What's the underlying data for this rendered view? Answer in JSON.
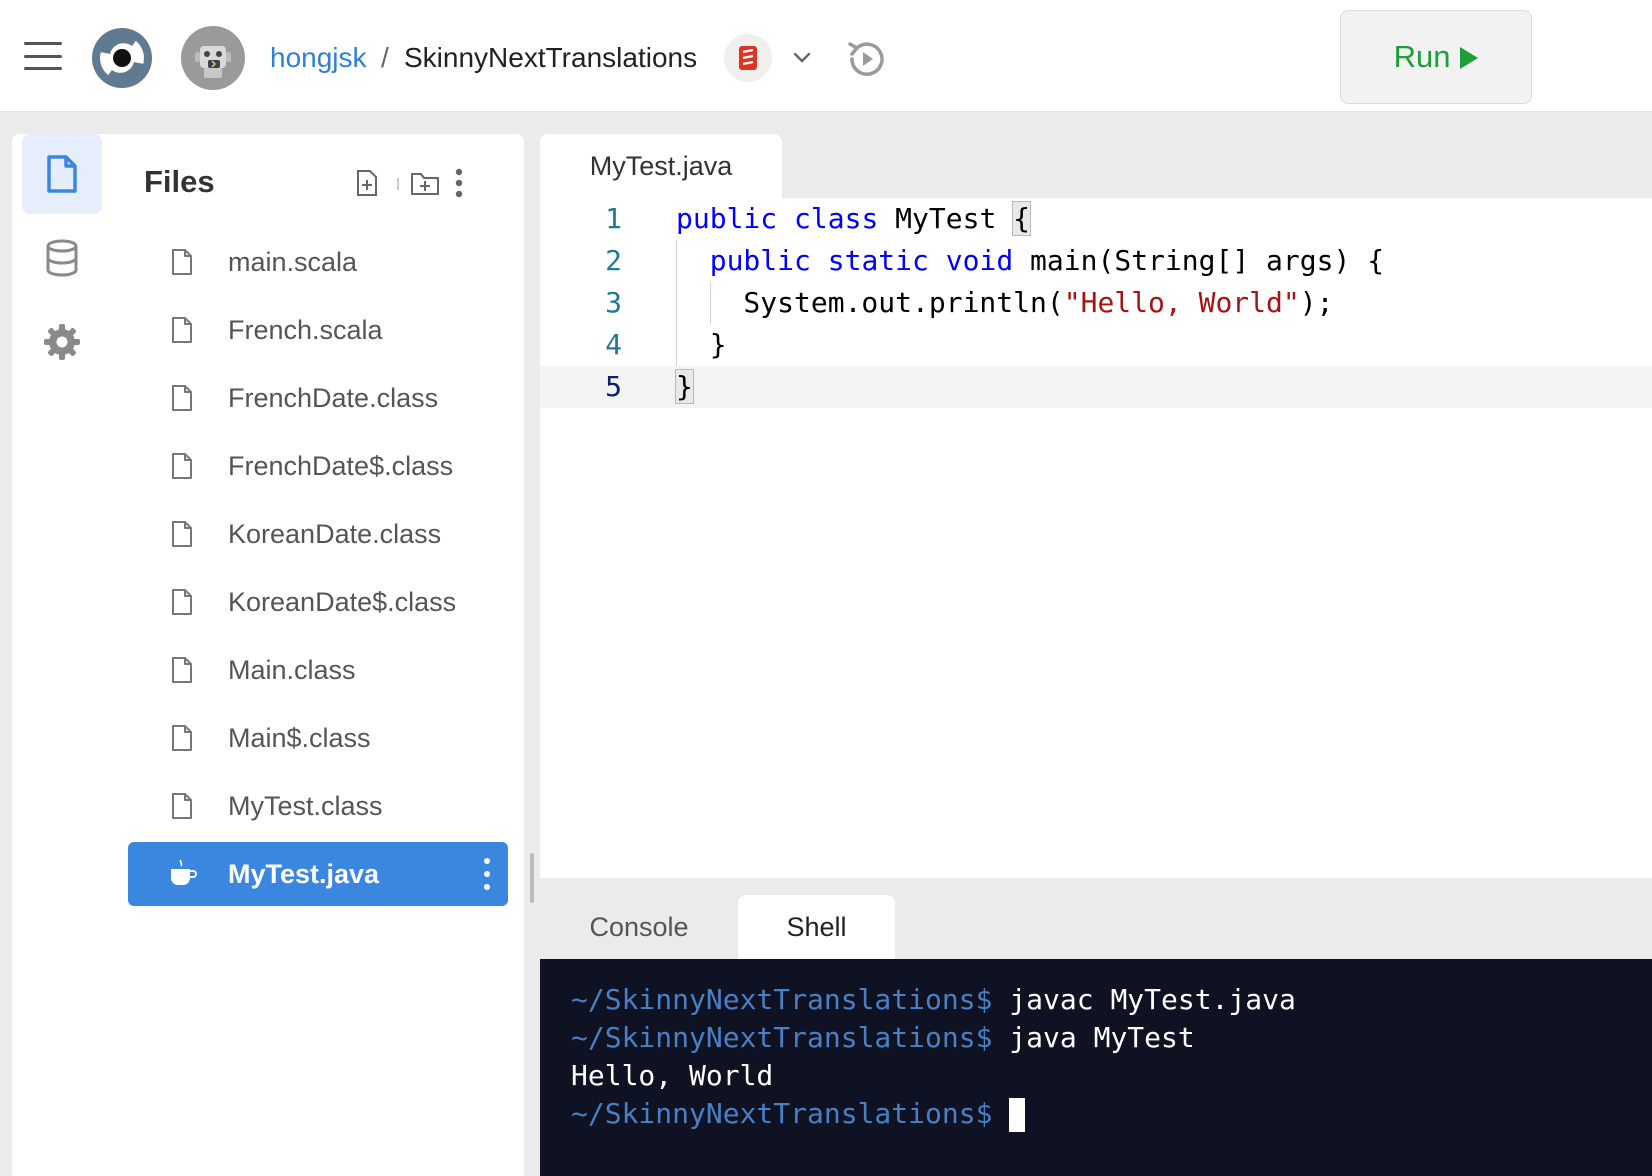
{
  "header": {
    "username": "hongjsk",
    "separator": "/",
    "repl_name": "SkinnyNextTranslations",
    "run_label": "Run"
  },
  "files_panel": {
    "title": "Files",
    "items": [
      {
        "name": "main.scala"
      },
      {
        "name": "French.scala"
      },
      {
        "name": "FrenchDate.class"
      },
      {
        "name": "FrenchDate$.class"
      },
      {
        "name": "KoreanDate.class"
      },
      {
        "name": "KoreanDate$.class"
      },
      {
        "name": "Main.class"
      },
      {
        "name": "Main$.class"
      },
      {
        "name": "MyTest.class"
      },
      {
        "name": "MyTest.java",
        "active": true
      }
    ]
  },
  "editor": {
    "tab_label": "MyTest.java",
    "line_numbers": [
      "1",
      "2",
      "3",
      "4",
      "5"
    ],
    "current_line": 5
  },
  "bottom_panel": {
    "tabs": [
      "Console",
      "Shell"
    ],
    "active_tab": "Shell",
    "terminal_lines": [
      {
        "prompt": "~/SkinnyNextTranslations$",
        "text": " javac MyTest.java"
      },
      {
        "prompt": "~/SkinnyNextTranslations$",
        "text": " java MyTest"
      },
      {
        "prompt": "",
        "text": "Hello, World"
      },
      {
        "prompt": "~/SkinnyNextTranslations$",
        "text": " "
      }
    ]
  },
  "colors": {
    "accent": "#3b87e0",
    "run_green": "#1f9d3a",
    "terminal_bg": "#0e1222",
    "prompt_blue": "#4a7fc4"
  }
}
